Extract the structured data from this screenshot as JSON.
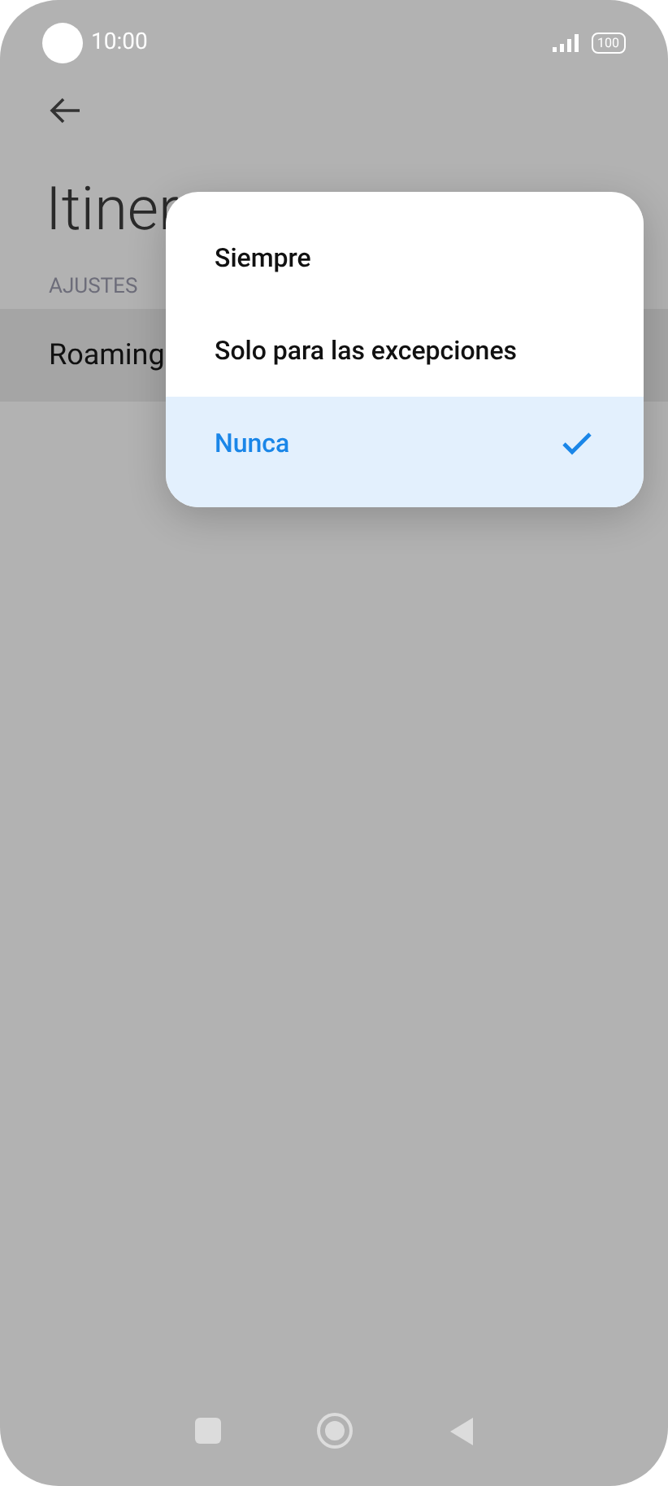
{
  "status_bar": {
    "time": "10:00",
    "battery": "100"
  },
  "page": {
    "title": "Itiner",
    "section": "AJUSTES",
    "rows": [
      {
        "label": "Roaming"
      }
    ]
  },
  "menu": {
    "options": [
      {
        "label": "Siempre",
        "selected": false
      },
      {
        "label": "Solo para las excepciones",
        "selected": false
      },
      {
        "label": "Nunca",
        "selected": true
      }
    ]
  }
}
